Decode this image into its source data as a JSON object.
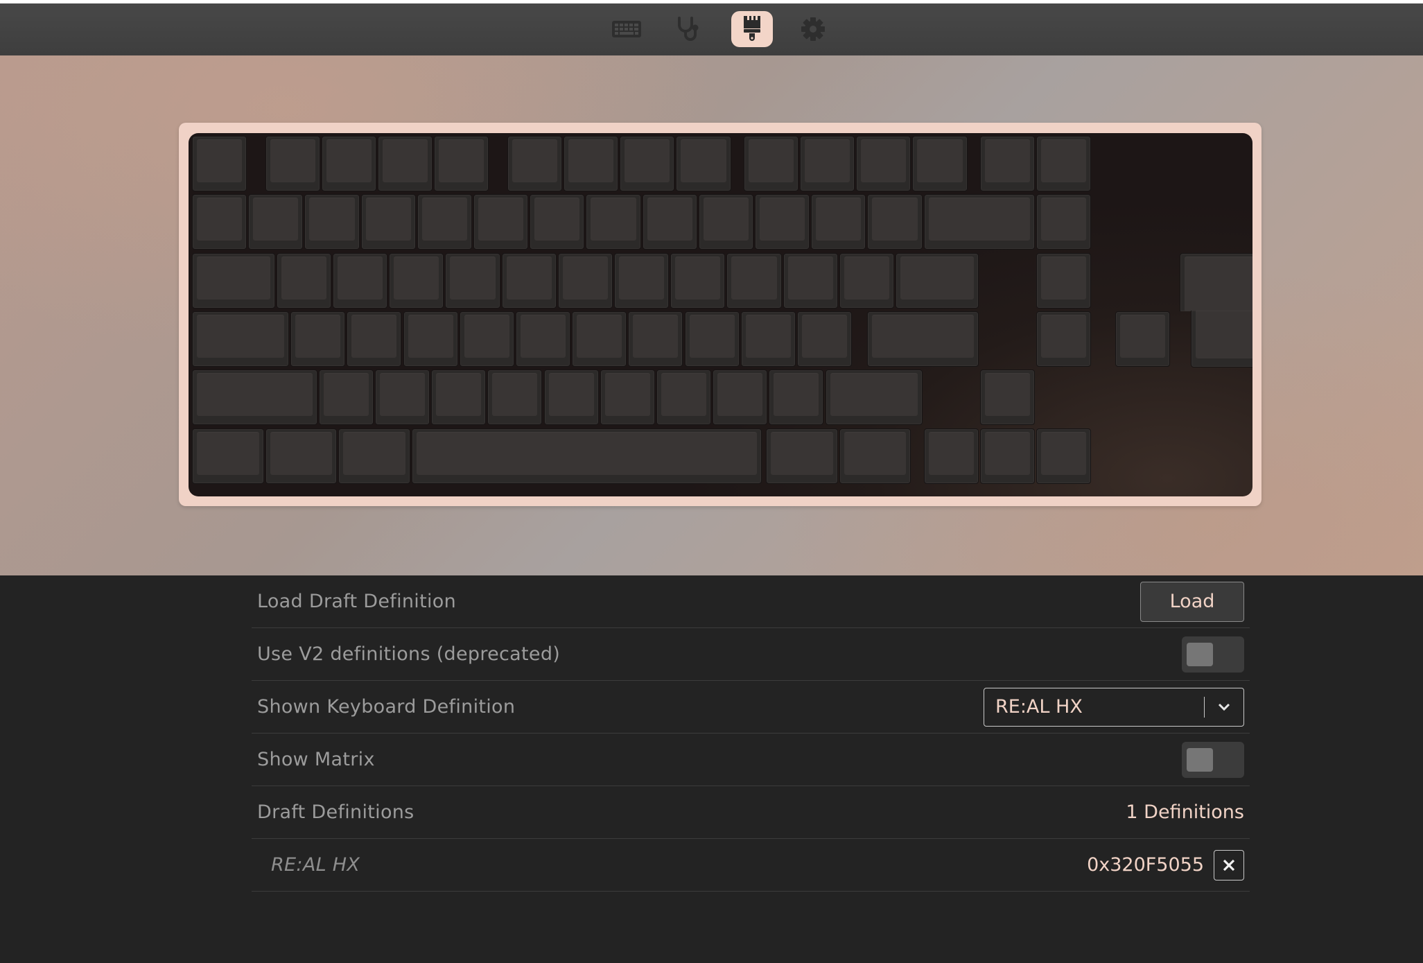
{
  "nav": {
    "items": [
      {
        "icon": "keyboard-icon",
        "active": false
      },
      {
        "icon": "stethoscope-icon",
        "active": false
      },
      {
        "icon": "paintbrush-icon",
        "active": true
      },
      {
        "icon": "gear-icon",
        "active": false
      }
    ]
  },
  "colors": {
    "accent": "#f1d3c6",
    "case": "#f0d2c6",
    "background": "#232323",
    "navbar": "#444444",
    "keycap": "#393534"
  },
  "settings": {
    "load_draft": {
      "label": "Load Draft Definition",
      "button": "Load"
    },
    "use_v2": {
      "label": "Use V2 definitions (deprecated)",
      "enabled": false
    },
    "shown_definition": {
      "label": "Shown Keyboard Definition",
      "value": "RE:AL HX"
    },
    "show_matrix": {
      "label": "Show Matrix",
      "enabled": false
    },
    "draft_definitions": {
      "label": "Draft Definitions",
      "count": "1 Definitions"
    },
    "definitions": [
      {
        "name": "RE:AL HX",
        "vendor_product_id": "0x320F5055"
      }
    ]
  }
}
